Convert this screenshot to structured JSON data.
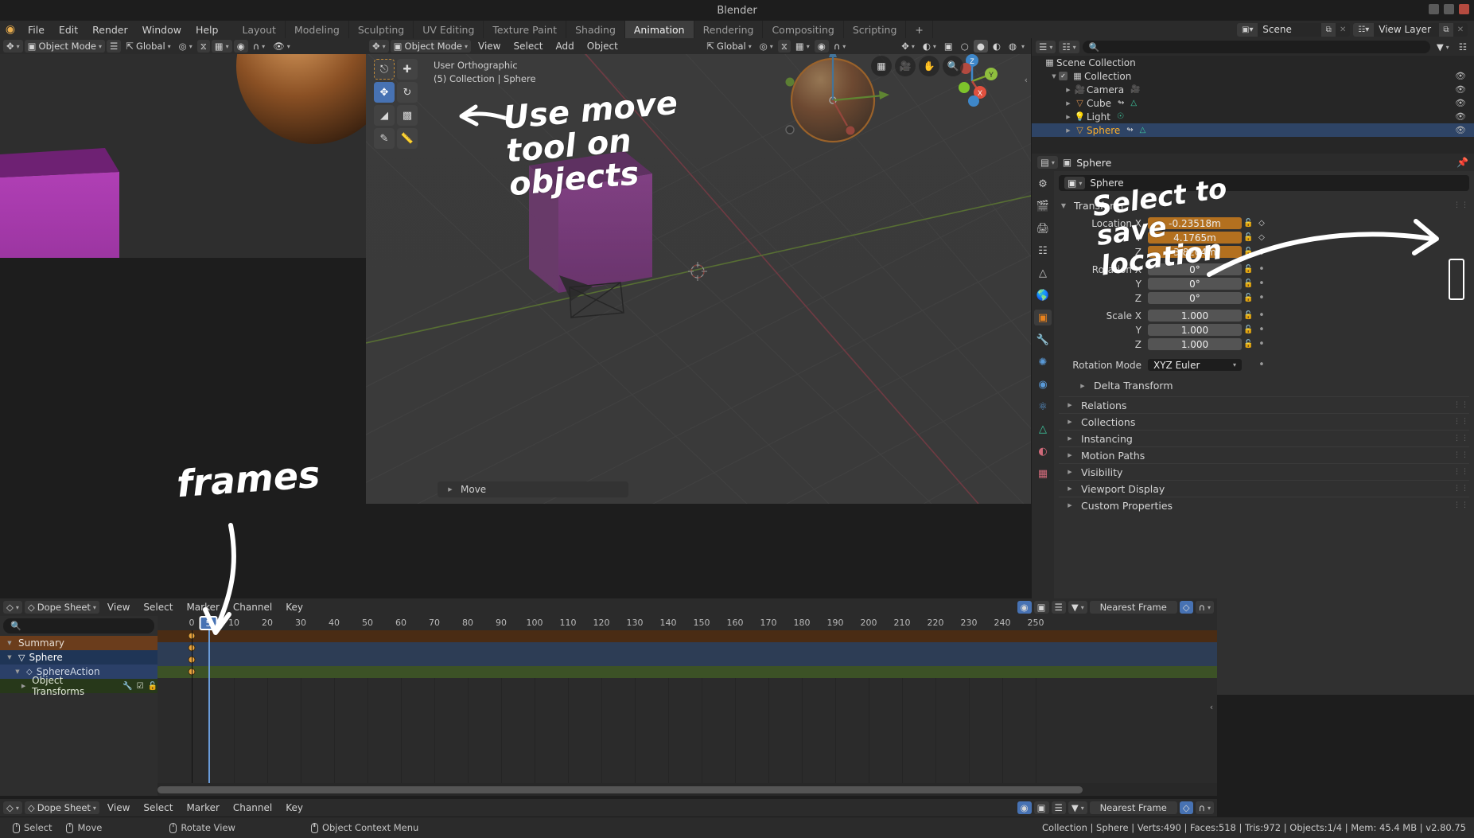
{
  "window": {
    "title": "Blender"
  },
  "menu": {
    "logo": "blender-logo",
    "items": [
      "File",
      "Edit",
      "Render",
      "Window",
      "Help"
    ]
  },
  "workspace_tabs": [
    {
      "label": "Layout",
      "active": false
    },
    {
      "label": "Modeling",
      "active": false
    },
    {
      "label": "Sculpting",
      "active": false
    },
    {
      "label": "UV Editing",
      "active": false
    },
    {
      "label": "Texture Paint",
      "active": false
    },
    {
      "label": "Shading",
      "active": false
    },
    {
      "label": "Animation",
      "active": true
    },
    {
      "label": "Rendering",
      "active": false
    },
    {
      "label": "Compositing",
      "active": false
    },
    {
      "label": "Scripting",
      "active": false
    },
    {
      "label": "+",
      "active": false
    }
  ],
  "scene_controls": {
    "scene_icon": "scene-icon",
    "scene_name": "Scene",
    "new_scene_icon": "duplicate-icon",
    "remove_scene_icon": "close-icon",
    "viewlayer_icon": "view-layer-icon",
    "viewlayer_name": "View Layer",
    "new_layer_icon": "duplicate-icon",
    "remove_layer_icon": "close-icon"
  },
  "left_viewport_header": {
    "editor_icon": "editor-type-icon",
    "mode": "Object Mode",
    "menu_icon": "hamburger-icon",
    "orientation": "Global",
    "pivot_icon": "pivot-icon",
    "snap_icon": "magnet-icon",
    "snap_mode_icon": "snap-increment-icon",
    "proportional_icon": "proportional-edit-icon",
    "falloff_icon": "falloff-curve-icon",
    "visibility_icon": "eye-dropdown-icon"
  },
  "viewport_header": {
    "editor_icon": "editor-type-icon",
    "mode": "Object Mode",
    "menus": [
      "View",
      "Select",
      "Add",
      "Object"
    ],
    "orientation": "Global",
    "pivot_icon": "pivot-icon",
    "snap_icon": "magnet-icon",
    "snap_mode_icon": "snap-increment-icon",
    "proportional_icon": "proportional-edit-icon",
    "shading_icons": [
      "wireframe-icon",
      "solid-icon",
      "material-preview-icon",
      "rendered-icon"
    ],
    "overlays_icon": "overlays-icon",
    "xray_icon": "xray-icon",
    "gizmo_icon": "gizmo-icon"
  },
  "viewport": {
    "view_name": "User Orthographic",
    "collection_line": "(5) Collection | Sphere",
    "operator_panel": "Move",
    "toolbar": [
      {
        "name": "tweak-select-tool",
        "icon": "cursor-box-select-icon",
        "active": false
      },
      {
        "name": "cursor-tool",
        "icon": "3d-cursor-icon",
        "active": false
      },
      {
        "name": "move-tool",
        "icon": "move-arrows-icon",
        "active": true
      },
      {
        "name": "rotate-tool",
        "icon": "rotate-icon",
        "active": false
      },
      {
        "name": "scale-tool",
        "icon": "scale-icon",
        "active": false
      },
      {
        "name": "transform-tool",
        "icon": "transform-icon",
        "active": false
      },
      {
        "name": "annotate-tool",
        "icon": "pencil-icon",
        "active": false
      },
      {
        "name": "measure-tool",
        "icon": "ruler-icon",
        "active": false
      }
    ],
    "nav_icons": [
      "grid-overlay-icon",
      "camera-view-icon",
      "pan-hand-icon",
      "zoom-magnifier-icon"
    ],
    "axis_labels": [
      "X",
      "Y",
      "Z"
    ]
  },
  "outliner": {
    "display_mode_icon": "outliner-display-icon",
    "filter_icon": "filter-icon",
    "new_collection_icon": "new-collection-icon",
    "search_placeholder": "",
    "rows": [
      {
        "label": "Scene Collection",
        "icon": "collection-icon",
        "indent": 0,
        "tri": "",
        "check": false,
        "eye": false,
        "selected": false,
        "badges": []
      },
      {
        "label": "Collection",
        "icon": "collection-icon",
        "indent": 1,
        "tri": "down",
        "check": true,
        "eye": true,
        "selected": false,
        "badges": []
      },
      {
        "label": "Camera",
        "icon": "camera-obj-icon",
        "indent": 2,
        "tri": "right",
        "check": false,
        "eye": true,
        "selected": false,
        "badges": [
          "camera-data-icon"
        ]
      },
      {
        "label": "Cube",
        "icon": "mesh-obj-icon",
        "indent": 2,
        "tri": "right",
        "check": false,
        "eye": true,
        "selected": false,
        "badges": [
          "animation-icon",
          "mesh-data-icon"
        ]
      },
      {
        "label": "Light",
        "icon": "light-obj-icon",
        "indent": 2,
        "tri": "right",
        "check": false,
        "eye": true,
        "selected": false,
        "badges": [
          "light-data-icon"
        ]
      },
      {
        "label": "Sphere",
        "icon": "mesh-obj-icon",
        "indent": 2,
        "tri": "right",
        "check": false,
        "eye": true,
        "selected": true,
        "badges": [
          "animation-icon",
          "mesh-data-icon"
        ]
      }
    ]
  },
  "properties": {
    "breadcrumb_icon": "object-properties-icon",
    "breadcrumb": "Sphere",
    "pin_icon": "pin-icon",
    "id_icon": "object-icon",
    "id_name": "Sphere",
    "tabs": [
      {
        "name": "tool",
        "icon": "tool-icon",
        "active": false
      },
      {
        "name": "render",
        "icon": "render-camera-icon",
        "active": false
      },
      {
        "name": "output",
        "icon": "printer-icon",
        "active": false
      },
      {
        "name": "view-layer",
        "icon": "images-icon",
        "active": false
      },
      {
        "name": "scene",
        "icon": "scene-cone-icon",
        "active": false
      },
      {
        "name": "world",
        "icon": "world-globe-icon",
        "active": false
      },
      {
        "name": "object",
        "icon": "object-square-icon",
        "active": true
      },
      {
        "name": "modifiers",
        "icon": "wrench-icon",
        "active": false
      },
      {
        "name": "particles",
        "icon": "particles-icon",
        "active": false
      },
      {
        "name": "physics",
        "icon": "physics-orbit-icon",
        "active": false
      },
      {
        "name": "constraints",
        "icon": "constraint-icon",
        "active": false
      },
      {
        "name": "data",
        "icon": "mesh-data-triangle-icon",
        "active": false
      },
      {
        "name": "material",
        "icon": "material-sphere-icon",
        "active": false
      },
      {
        "name": "texture",
        "icon": "texture-checker-icon",
        "active": false
      }
    ],
    "transform_panel": {
      "title": "Transform",
      "fields": [
        {
          "label": "Location X",
          "value": "-0.23518m",
          "animated": true,
          "keyed": true
        },
        {
          "label": "Y",
          "value": "4.1765m",
          "animated": true,
          "keyed": true
        },
        {
          "label": "Z",
          "value": "3.8204m",
          "animated": true,
          "keyed": true
        },
        {
          "label": "Rotation X",
          "value": "0°",
          "animated": false,
          "keyed": false
        },
        {
          "label": "Y",
          "value": "0°",
          "animated": false,
          "keyed": false
        },
        {
          "label": "Z",
          "value": "0°",
          "animated": false,
          "keyed": false
        },
        {
          "label": "Scale X",
          "value": "1.000",
          "animated": false,
          "keyed": false
        },
        {
          "label": "Y",
          "value": "1.000",
          "animated": false,
          "keyed": false
        },
        {
          "label": "Z",
          "value": "1.000",
          "animated": false,
          "keyed": false
        }
      ],
      "rotation_mode_label": "Rotation Mode",
      "rotation_mode_value": "XYZ Euler",
      "delta_transform": "Delta Transform"
    },
    "panels": [
      "Relations",
      "Collections",
      "Instancing",
      "Motion Paths",
      "Visibility",
      "Viewport Display",
      "Custom Properties"
    ]
  },
  "dopesheet": {
    "editor_icon": "dopesheet-editor-icon",
    "mode_icon": "dopesheet-mode-icon",
    "mode": "Dope Sheet",
    "menus": [
      "View",
      "Select",
      "Marker",
      "Channel",
      "Key"
    ],
    "search_placeholder": "",
    "filter_icons": [
      "proportional-icon",
      "only-selected-icon",
      "show-hidden-icon",
      "filter-funnel-icon"
    ],
    "snap_value": "Nearest Frame",
    "autosnap_icon": "snap-icon",
    "proportional_icon": "proportional-icon",
    "current_frame": "5",
    "ruler_ticks": [
      "0",
      "10",
      "20",
      "30",
      "40",
      "50",
      "60",
      "70",
      "80",
      "90",
      "100",
      "110",
      "120",
      "130",
      "140",
      "150",
      "160",
      "170",
      "180",
      "190",
      "200",
      "210",
      "220",
      "230",
      "240",
      "250"
    ],
    "channels": [
      {
        "label": "Summary",
        "kind": "summary",
        "tri": "down",
        "keys": [
          5
        ]
      },
      {
        "label": "Sphere",
        "kind": "obj",
        "tri": "down",
        "icon": "mesh-obj-icon",
        "keys": [
          5
        ]
      },
      {
        "label": "SphereAction",
        "kind": "act",
        "tri": "down",
        "icon": "action-icon",
        "keys": [
          5
        ]
      },
      {
        "label": "Object Transforms",
        "kind": "xform",
        "tri": "right",
        "icon": "modifier-icon",
        "keys": [
          5
        ]
      }
    ]
  },
  "status_bar": {
    "hints": [
      {
        "icon": "mouse-left-icon",
        "label": "Select"
      },
      {
        "icon": "mouse-left-drag-icon",
        "label": "Move"
      },
      {
        "icon": "mouse-middle-icon",
        "label": "Rotate View"
      },
      {
        "icon": "mouse-right-icon",
        "label": "Object Context Menu"
      }
    ],
    "info": "Collection | Sphere | Verts:490 | Faces:518 | Tris:972 | Objects:1/4 | Mem: 45.4 MB | v2.80.75"
  },
  "annotations": [
    {
      "name": "use-move-tool-note",
      "text": "Use move tool on objects"
    },
    {
      "name": "select-to-save-location-note",
      "text": "Select to save location"
    },
    {
      "name": "frames-note",
      "text": "frames"
    }
  ],
  "colors": {
    "accent_blue": "#4772b3",
    "animated_orange": "#b3701f",
    "selected_outliner": "#ffaf29",
    "key_yellow": "#e8a33d",
    "summary_brown": "#6b3d1c",
    "xform_green": "#27381a"
  }
}
